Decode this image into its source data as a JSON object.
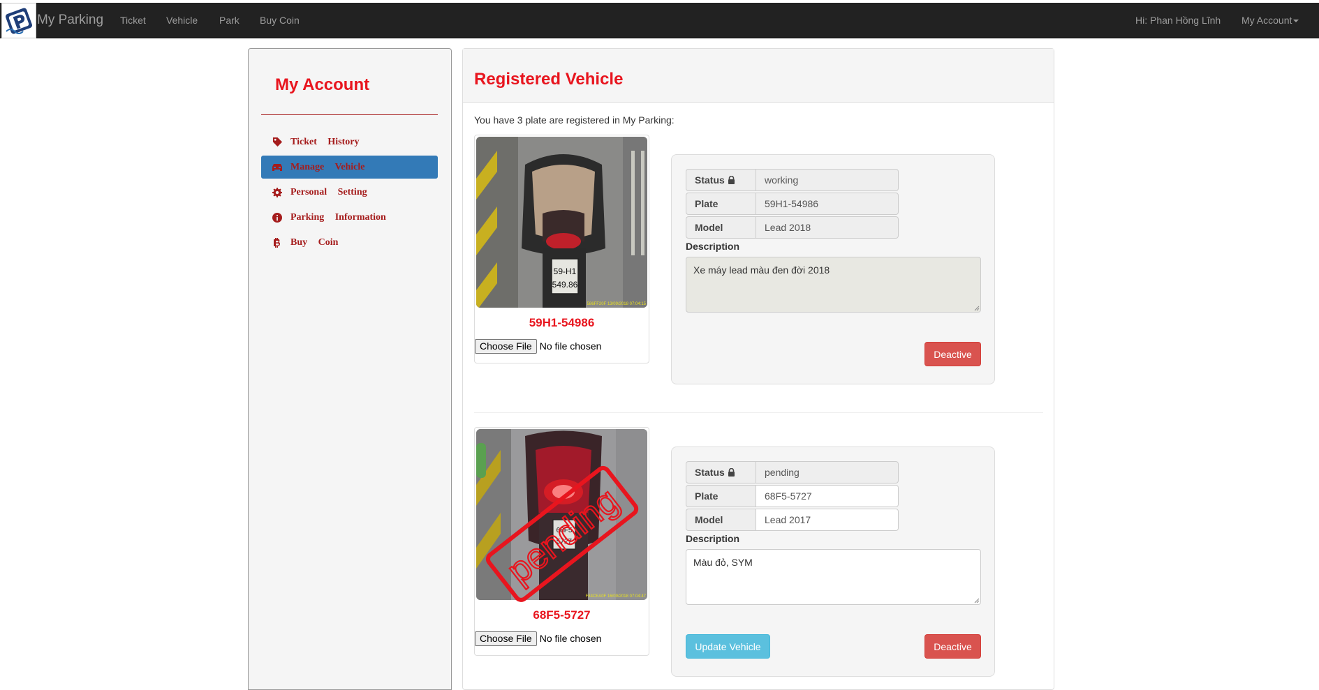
{
  "navbar": {
    "brand": "My Parking",
    "links": [
      "Ticket",
      "Vehicle",
      "Park",
      "Buy Coin"
    ],
    "greeting": "Hi: Phan Hồng Lĩnh",
    "account_menu": "My Account"
  },
  "sidebar": {
    "title": "My Account",
    "items": [
      {
        "label": "Ticket History",
        "icon": "tag-icon"
      },
      {
        "label": "Manage Vehicle",
        "icon": "car-icon",
        "active": true
      },
      {
        "label": "Personal Setting",
        "icon": "gear-icon"
      },
      {
        "label": "Parking Information",
        "icon": "info-icon"
      },
      {
        "label": "Buy Coin",
        "icon": "bitcoin-icon"
      }
    ]
  },
  "main": {
    "title": "Registered Vehicle",
    "intro": "You have 3 plate are registered in My Parking:",
    "vehicles": [
      {
        "plate_caption": "59H1-54986",
        "photo_plate_text": "59-H1 549.86",
        "photo_stamp": "586FF20F 13/09/2018 07:04:15",
        "choose_file": "Choose File",
        "no_file": "No file chosen",
        "status_label": "Status",
        "status": "working",
        "plate_label": "Plate",
        "plate": "59H1-54986",
        "model_label": "Model",
        "model": "Lead 2018",
        "description_label": "Description",
        "description": "Xe máy lead màu đen đời 2018",
        "deactive_label": "Deactive"
      },
      {
        "plate_caption": "68F5-5727",
        "photo_plate_text": "68F5 5727",
        "photo_stamp": "F84CEA0F 16/09/2018 07:04:47",
        "pending_stamp": "pending",
        "choose_file": "Choose File",
        "no_file": "No file chosen",
        "status_label": "Status",
        "status": "pending",
        "plate_label": "Plate",
        "plate": "68F5-5727",
        "model_label": "Model",
        "model": "Lead 2017",
        "description_label": "Description",
        "description": "Màu đỏ, SYM",
        "update_label": "Update Vehicle",
        "deactive_label": "Deactive"
      }
    ]
  },
  "colors": {
    "accent_red": "#e8151e",
    "nav_bg": "#222222",
    "active_blue": "#337ab7",
    "danger": "#d9534f",
    "info": "#5bc0de"
  }
}
